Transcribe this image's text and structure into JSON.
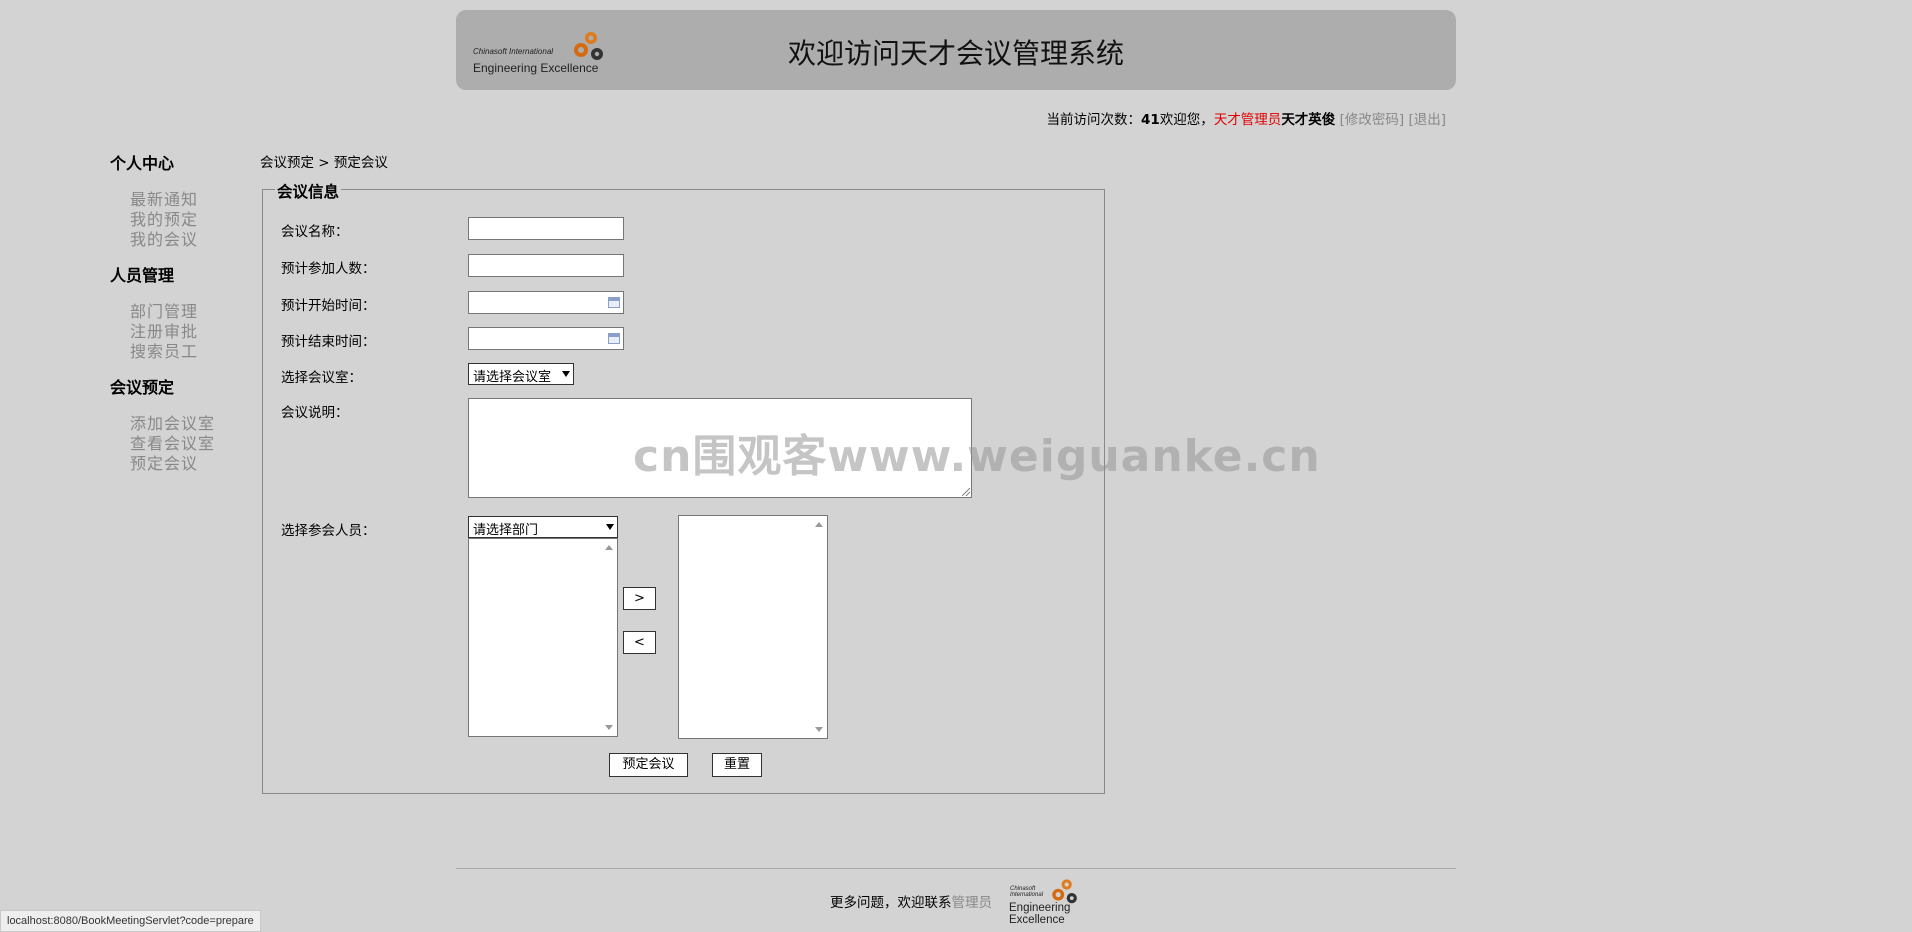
{
  "header": {
    "logo_line1": "Chinasoft International",
    "logo_line2": "Engineering Excellence",
    "title": "欢迎访问天才会议管理系统"
  },
  "userbar": {
    "visits_label": "当前访问次数：",
    "visits": "41",
    "welcome": "欢迎您，",
    "role": "天才管理员",
    "username": "天才英俊",
    "change_password": "[修改密码]",
    "logout": "[退出]"
  },
  "sidebar": {
    "groups": [
      {
        "title": "个人中心",
        "items": [
          "最新通知",
          "我的预定",
          "我的会议"
        ]
      },
      {
        "title": "人员管理",
        "items": [
          "部门管理",
          "注册审批",
          "搜索员工"
        ]
      },
      {
        "title": "会议预定",
        "items": [
          "添加会议室",
          "查看会议室",
          "预定会议"
        ]
      }
    ]
  },
  "breadcrumb": "会议预定 > 预定会议",
  "form": {
    "legend": "会议信息",
    "name_label": "会议名称：",
    "name_value": "",
    "people_label": "预计参加人数：",
    "people_value": "",
    "start_label": "预计开始时间：",
    "start_value": "",
    "end_label": "预计结束时间：",
    "end_value": "",
    "room_label": "选择会议室：",
    "room_selected": "请选择会议室",
    "desc_label": "会议说明：",
    "desc_value": "",
    "participants_label": "选择参会人员：",
    "dept_selected": "请选择部门",
    "add_button": ">",
    "remove_button": "<",
    "submit_button": "预定会议",
    "reset_button": "重置"
  },
  "footer": {
    "text": "更多问题，欢迎联系",
    "admin_link": "管理员",
    "logo_line1": "Chinasoft International",
    "logo_line2": "Engineering Excellence"
  },
  "watermark": "cn围观客www.weiguanke.cn",
  "statusbar": "localhost:8080/BookMeetingServlet?code=prepare"
}
